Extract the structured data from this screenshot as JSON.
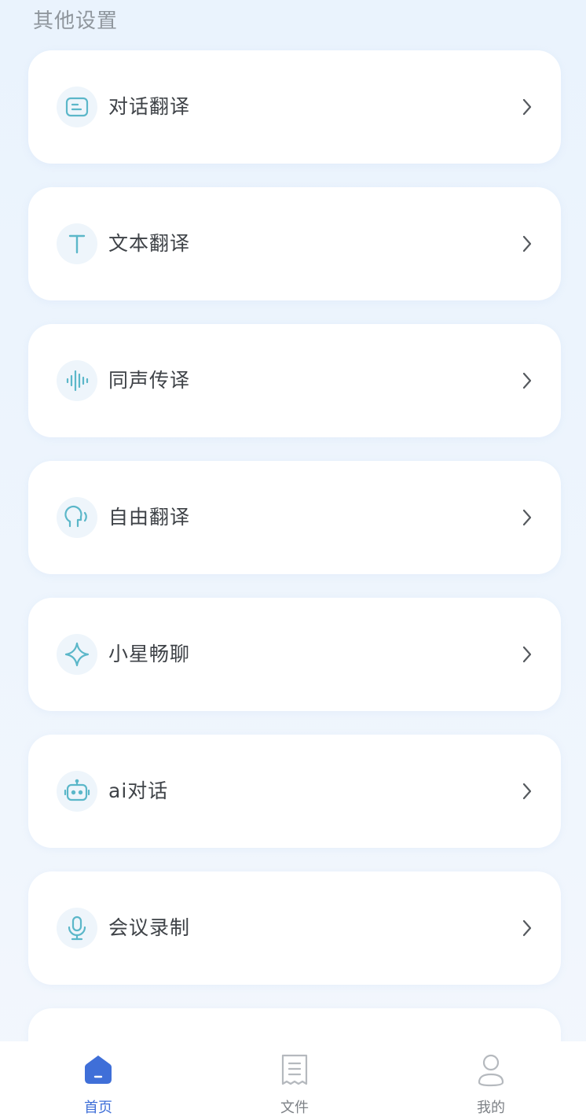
{
  "section_title": "其他设置",
  "items": [
    {
      "label": "对话翻译",
      "icon": "chat-bubble-icon"
    },
    {
      "label": "文本翻译",
      "icon": "text-t-icon"
    },
    {
      "label": "同声传译",
      "icon": "sound-wave-icon"
    },
    {
      "label": "自由翻译",
      "icon": "speaking-head-icon"
    },
    {
      "label": "小星畅聊",
      "icon": "sparkle-star-icon"
    },
    {
      "label": "ai对话",
      "icon": "robot-icon"
    },
    {
      "label": "会议录制",
      "icon": "microphone-icon"
    }
  ],
  "tabbar": {
    "tabs": [
      {
        "label": "首页",
        "icon": "home-icon",
        "active": true
      },
      {
        "label": "文件",
        "icon": "document-icon",
        "active": false
      },
      {
        "label": "我的",
        "icon": "user-icon",
        "active": false
      }
    ]
  },
  "colors": {
    "accent": "#3f6fd8",
    "icon_teal": "#5bb7c9",
    "text_primary": "#3e4247",
    "text_muted": "#8f969d"
  }
}
